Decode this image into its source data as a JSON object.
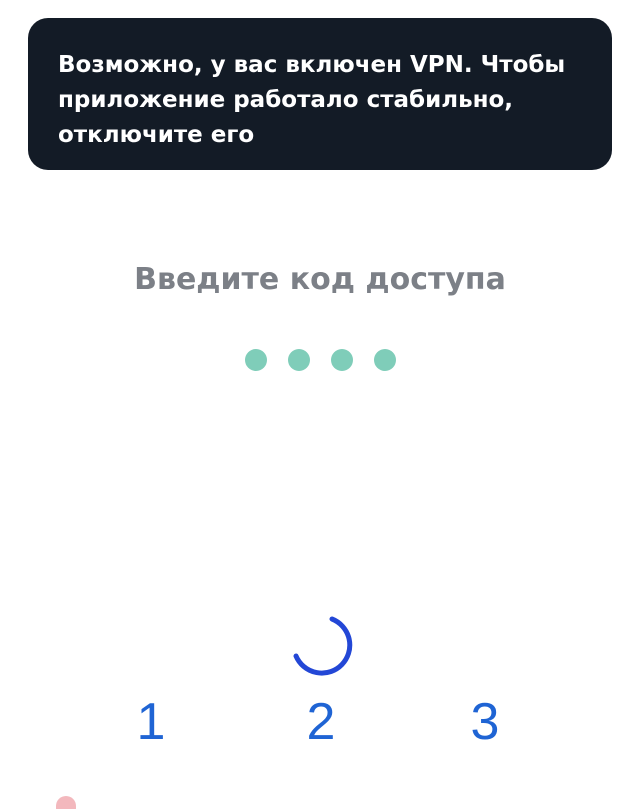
{
  "toast": {
    "lines": [
      "Возможно, у вас включен VPN. Чтобы",
      "приложение работало стабильно,",
      "отключите его"
    ]
  },
  "pin": {
    "title": "Введите код доступа",
    "dots_total": 4
  },
  "keypad": {
    "keys": [
      "1",
      "2",
      "3"
    ]
  },
  "colors": {
    "toast_background": "#131b26",
    "title_text": "#7c8087",
    "pin_dot": "#7fcdb9",
    "key_text": "#1f64d4",
    "spinner": "#2347d6"
  },
  "icons": {
    "spinner": "loading-spinner-icon"
  }
}
